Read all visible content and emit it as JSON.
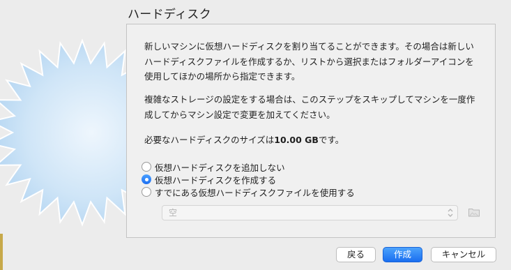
{
  "dialog": {
    "title": "ハードディスク"
  },
  "content": {
    "paragraph1": "新しいマシンに仮想ハードディスクを割り当てることができます。その場合は新しいハードディスクファイルを作成するか、リストから選択またはフォルダーアイコンを使用してほかの場所から指定できます。",
    "paragraph2": "複雑なストレージの設定をする場合は、このステップをスキップしてマシンを一度作成してからマシン設定で変更を加えてください。",
    "size_prefix": "必要なハードディスクのサイズは",
    "size_value": "10.00 GB",
    "size_suffix": "です。",
    "options": [
      {
        "label": "仮想ハードディスクを追加しない",
        "checked": false
      },
      {
        "label": "仮想ハードディスクを作成する",
        "checked": true
      },
      {
        "label": "すでにある仮想ハードディスクファイルを使用する",
        "checked": false
      }
    ],
    "disk_select": {
      "value": "空",
      "icon": "chevron-updown-icon",
      "enabled": false
    },
    "folder_icon": "folder-icon"
  },
  "buttons": {
    "back": "戻る",
    "create": "作成",
    "cancel": "キャンセル"
  },
  "colors": {
    "accent": "#1d6ff2",
    "background": "#ececec"
  }
}
